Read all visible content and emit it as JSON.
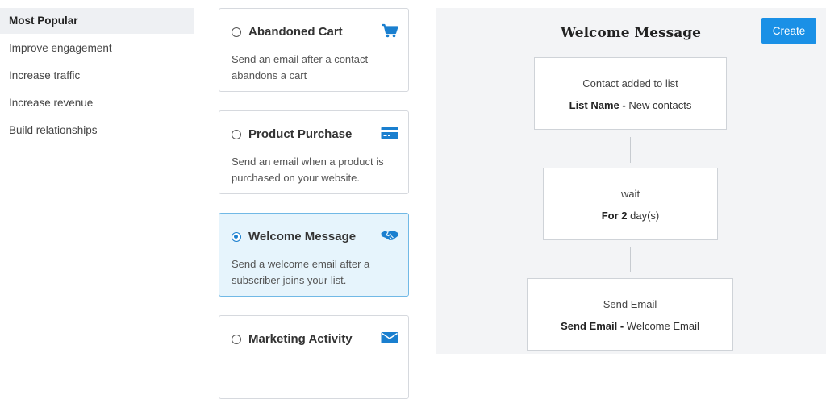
{
  "sidebar": {
    "items": [
      {
        "label": "Most Popular"
      },
      {
        "label": "Improve engagement"
      },
      {
        "label": "Increase traffic"
      },
      {
        "label": "Increase revenue"
      },
      {
        "label": "Build relationships"
      }
    ],
    "selected": "Most Popular"
  },
  "cards": [
    {
      "title": "Abandoned Cart",
      "description": "Send an email after a contact abandons a cart",
      "icon": "shopping-cart-icon",
      "selected": false
    },
    {
      "title": "Product Purchase",
      "description": "Send an email when a product is purchased on your website.",
      "icon": "credit-card-icon",
      "selected": false
    },
    {
      "title": "Welcome Message",
      "description": "Send a welcome email after a subscriber joins your list.",
      "icon": "handshake-icon",
      "selected": true
    },
    {
      "title": "Marketing Activity",
      "description": "",
      "icon": "envelope-icon",
      "selected": false
    }
  ],
  "preview": {
    "title": "Welcome Message",
    "create_label": "Create",
    "steps": [
      {
        "line1": "Contact added to list",
        "key": "List Name -",
        "value": "New contacts"
      },
      {
        "line1": "wait",
        "key": "For 2",
        "value": "day(s)"
      },
      {
        "line1": "Send Email",
        "key": "Send Email -",
        "value": "Welcome Email"
      }
    ]
  },
  "colors": {
    "accent": "#1a90e6",
    "icon_blue": "#1a7fcf",
    "selected_card_bg": "#e6f4fc",
    "panel_bg": "#f3f4f6"
  }
}
